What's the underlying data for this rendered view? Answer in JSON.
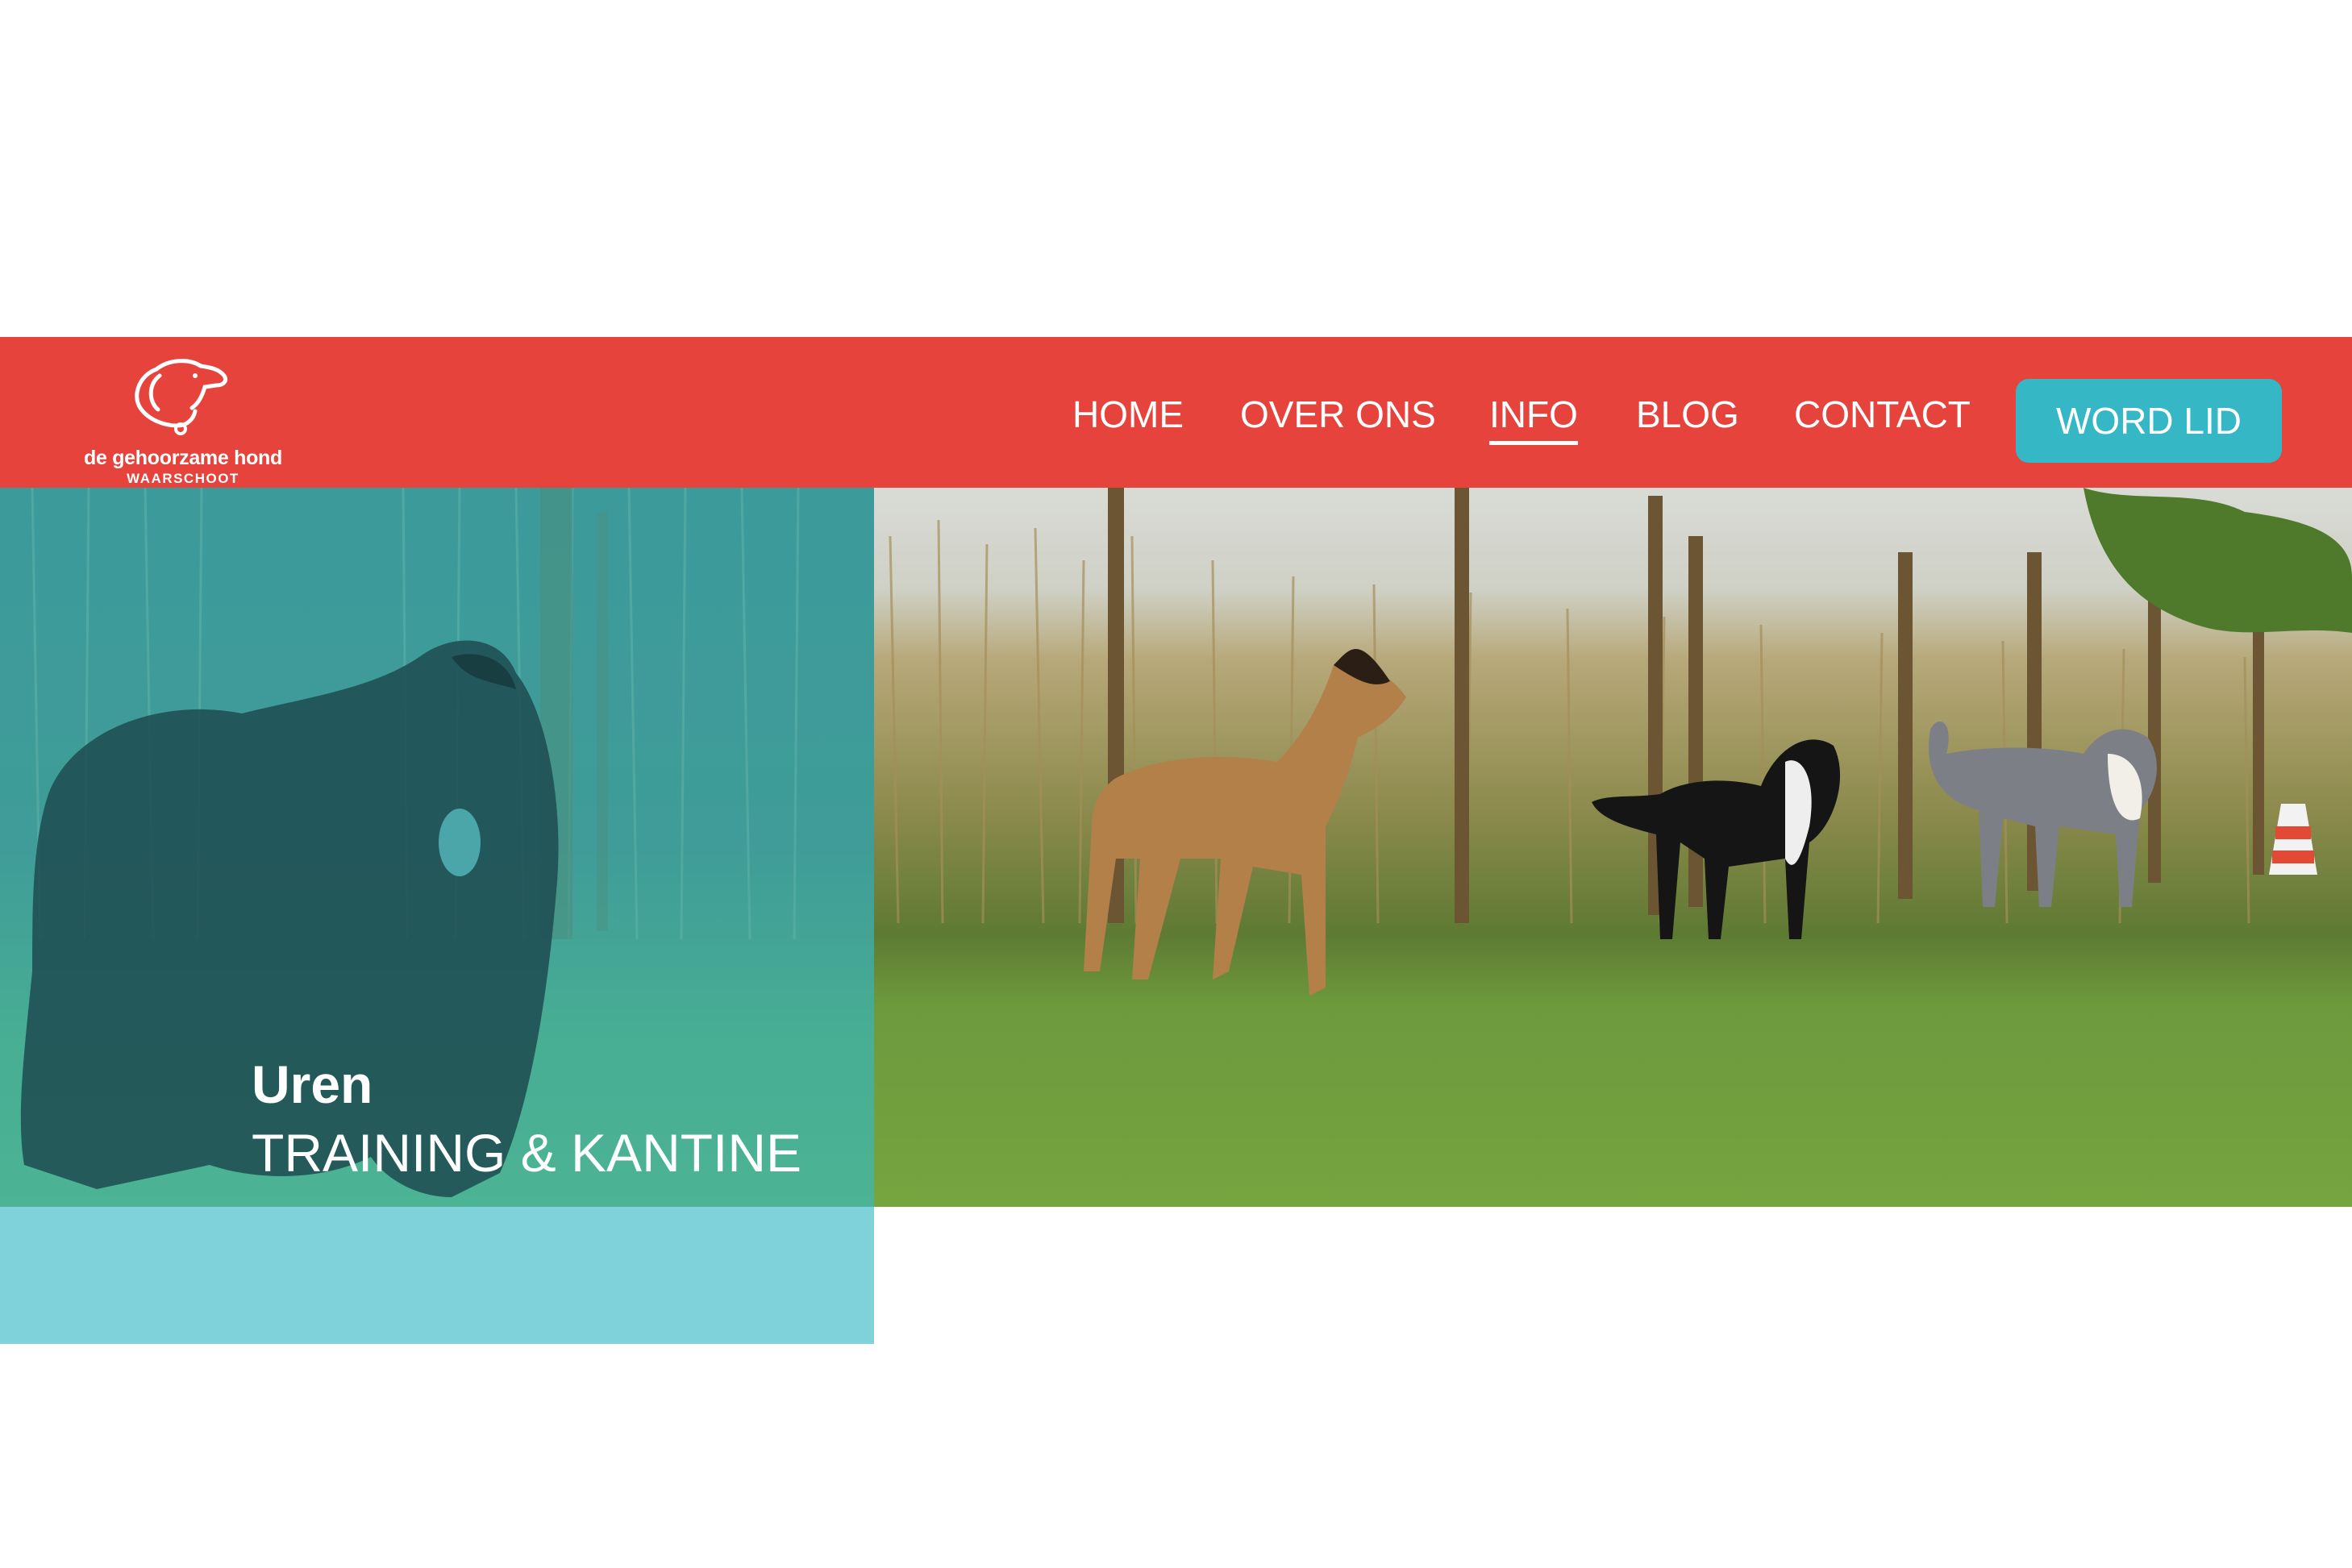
{
  "brand": {
    "name": "de gehoorzame hond",
    "location": "WAARSCHOOT",
    "logo_icon": "dog-head-icon"
  },
  "nav": {
    "items": [
      {
        "label": "HOME",
        "active": false
      },
      {
        "label": "OVER ONS",
        "active": false
      },
      {
        "label": "INFO",
        "active": true
      },
      {
        "label": "BLOG",
        "active": false
      },
      {
        "label": "CONTACT",
        "active": false
      }
    ],
    "cta_label": "WORD LID"
  },
  "hero": {
    "title": "Uren",
    "subtitle": "TRAINING & KANTINE"
  },
  "colors": {
    "header": "#e5433c",
    "cta": "#36b7c6",
    "panel_overlay": "#3fa39c",
    "panel_bottom": "#7fd1da",
    "text": "#ffffff"
  }
}
